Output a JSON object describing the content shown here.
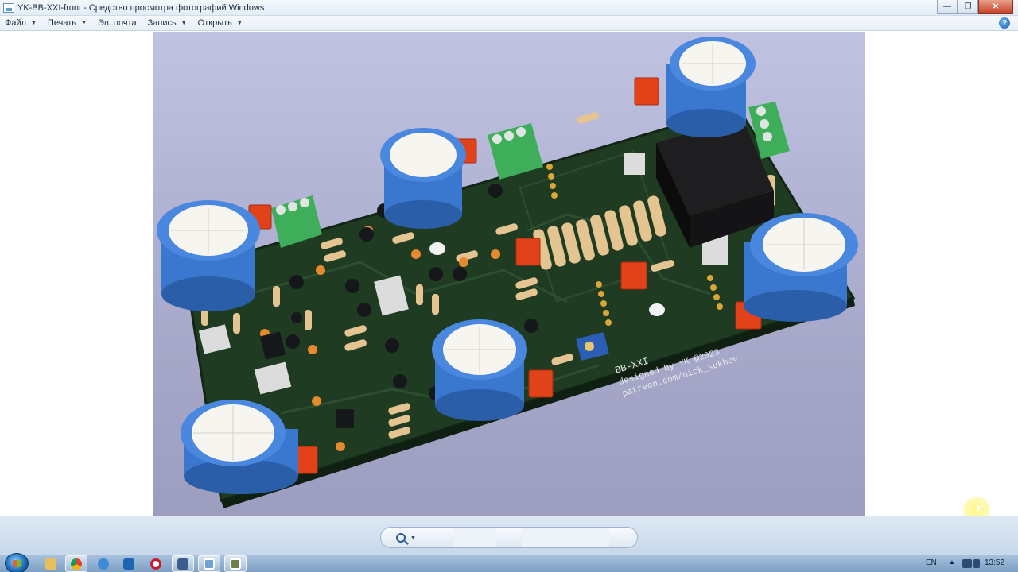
{
  "window": {
    "title": "YK-BB-XXI-front - Средство просмотра фотографий Windows"
  },
  "menu": {
    "items": [
      {
        "label": "Файл"
      },
      {
        "label": "Печать"
      },
      {
        "label": "Эл. почта"
      },
      {
        "label": "Запись"
      },
      {
        "label": "Открыть"
      }
    ],
    "help_icon": "help-icon"
  },
  "photo": {
    "board_text": {
      "name": "BB-XXI",
      "line2": "designed by YK @2023",
      "line3": "patreon.com/nick_sukhov"
    },
    "colors": {
      "board": "#1f3b22",
      "capacitor_sleeve": "#3a78d0",
      "terminal_block": "#3fae5a",
      "relay": "#1e1e20",
      "resistor": "#e4c491",
      "film_cap": "#e2421a"
    }
  },
  "controls": {
    "zoom_icon": "zoom-icon"
  },
  "taskbar": {
    "language": "EN",
    "clock": "13:52",
    "apps": [
      "explorer-icon",
      "chrome-icon",
      "ie-icon",
      "outlook-icon",
      "opera-icon",
      "floppy-icon",
      "photo-viewer-icon",
      "presentation-icon"
    ]
  }
}
